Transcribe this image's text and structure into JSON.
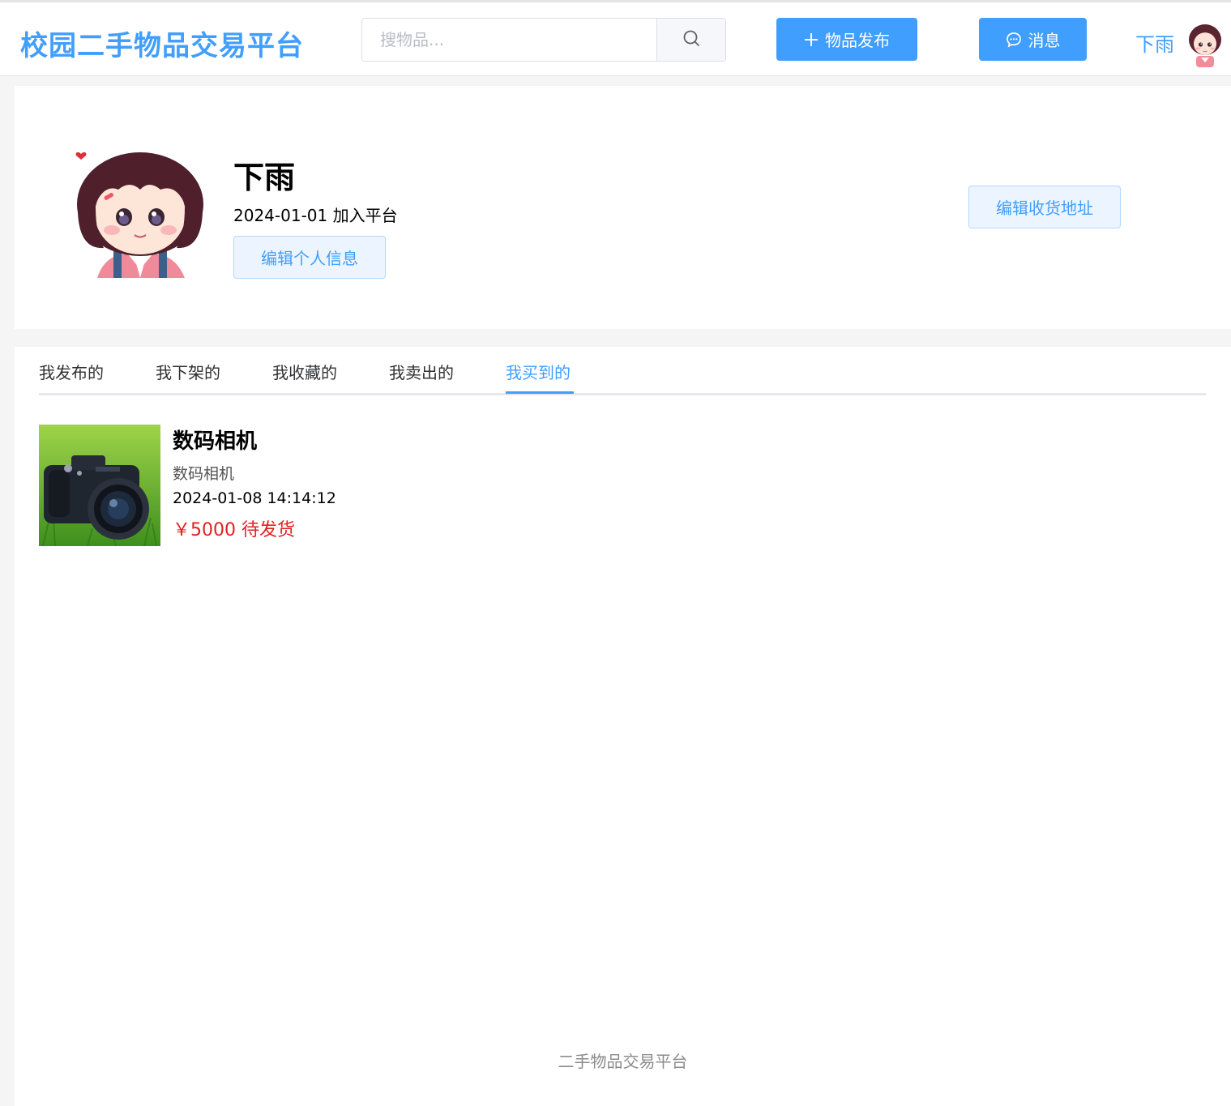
{
  "header": {
    "logo_text": "校园二手物品交易平台",
    "search_placeholder": "搜物品...",
    "publish_label": "物品发布",
    "message_label": "消息",
    "username": "下雨"
  },
  "profile": {
    "name": "下雨",
    "join_text": "2024-01-01 加入平台",
    "edit_info_label": "编辑个人信息",
    "edit_address_label": "编辑收货地址"
  },
  "tabs": [
    {
      "label": "我发布的"
    },
    {
      "label": "我下架的"
    },
    {
      "label": "我收藏的"
    },
    {
      "label": "我卖出的"
    },
    {
      "label": "我买到的",
      "active": true
    }
  ],
  "items": [
    {
      "title": "数码相机",
      "description": "数码相机",
      "time": "2024-01-08 14:14:12",
      "price_status": "￥5000 待发货"
    }
  ],
  "footer": {
    "text": "二手物品交易平台"
  },
  "colors": {
    "primary": "#409eff",
    "price": "#e02020",
    "background": "#f5f5f5"
  },
  "icons": {
    "search": "search-icon",
    "plus": "plus-icon",
    "chat": "chat-icon"
  }
}
